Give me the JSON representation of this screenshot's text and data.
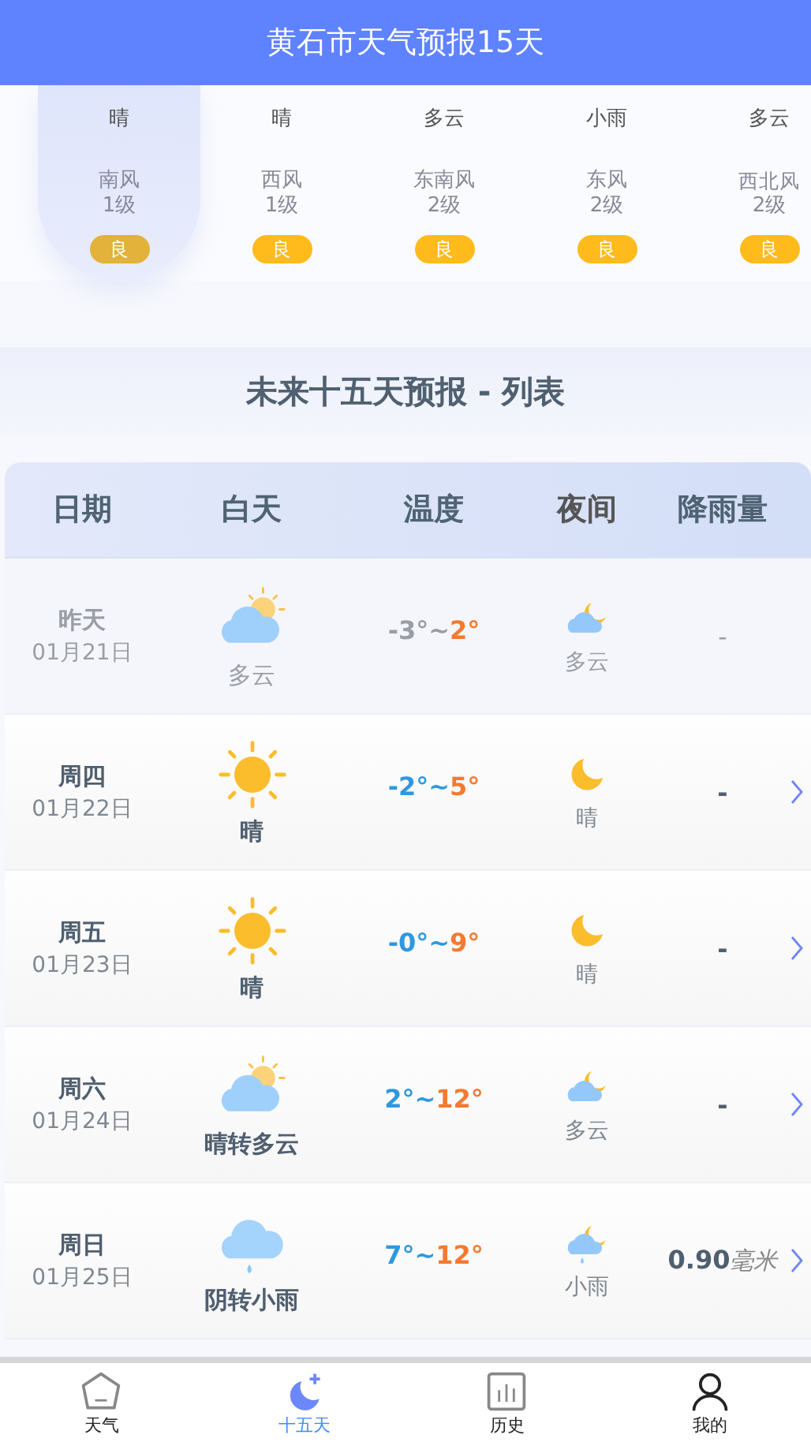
{
  "header": {
    "title": "黄石市天气预报15天"
  },
  "strip": [
    {
      "weather": "晴",
      "wind": "南风",
      "level": "1级",
      "aqi": "良",
      "selected": true
    },
    {
      "weather": "晴",
      "wind": "西风",
      "level": "1级",
      "aqi": "良",
      "selected": false
    },
    {
      "weather": "多云",
      "wind": "东南风",
      "level": "2级",
      "aqi": "良",
      "selected": false
    },
    {
      "weather": "小雨",
      "wind": "东风",
      "level": "2级",
      "aqi": "良",
      "selected": false
    },
    {
      "weather": "多云",
      "wind": "西北风",
      "level": "2级",
      "aqi": "良",
      "selected": false
    }
  ],
  "section_title": "未来十五天预报 - 列表",
  "table": {
    "columns": [
      "日期",
      "白天",
      "温度",
      "夜间",
      "降雨量"
    ],
    "rows": [
      {
        "past": true,
        "day": "昨天",
        "date": "01月21日",
        "daytime": {
          "kind": "cloudy",
          "weather": "多云"
        },
        "low": "-3°~",
        "high": "2°",
        "night": {
          "kind": "cloudy",
          "weather": "多云"
        },
        "rain": "-"
      },
      {
        "past": false,
        "day": "周四",
        "date": "01月22日",
        "daytime": {
          "kind": "clear",
          "weather": "晴"
        },
        "low": "-2°~",
        "high": "5°",
        "night": {
          "kind": "clear",
          "weather": "晴"
        },
        "rain": "-"
      },
      {
        "past": false,
        "day": "周五",
        "date": "01月23日",
        "daytime": {
          "kind": "clear",
          "weather": "晴"
        },
        "low": "-0°~",
        "high": "9°",
        "night": {
          "kind": "clear",
          "weather": "晴"
        },
        "rain": "-"
      },
      {
        "past": false,
        "day": "周六",
        "date": "01月24日",
        "daytime": {
          "kind": "cloudy",
          "weather": "晴转多云"
        },
        "low": "2°~",
        "high": "12°",
        "night": {
          "kind": "cloudy",
          "weather": "多云"
        },
        "rain": "-"
      },
      {
        "past": false,
        "day": "周日",
        "date": "01月25日",
        "daytime": {
          "kind": "rain",
          "weather": "阴转小雨"
        },
        "low": "7°~",
        "high": "12°",
        "night": {
          "kind": "rain",
          "weather": "小雨"
        },
        "rain": "0.90",
        "rain_unit": "毫米"
      }
    ]
  },
  "tabbar": [
    {
      "label": "天气",
      "selected": false
    },
    {
      "label": "十五天",
      "selected": true
    },
    {
      "label": "历史",
      "selected": false
    },
    {
      "label": "我的",
      "selected": false
    }
  ]
}
